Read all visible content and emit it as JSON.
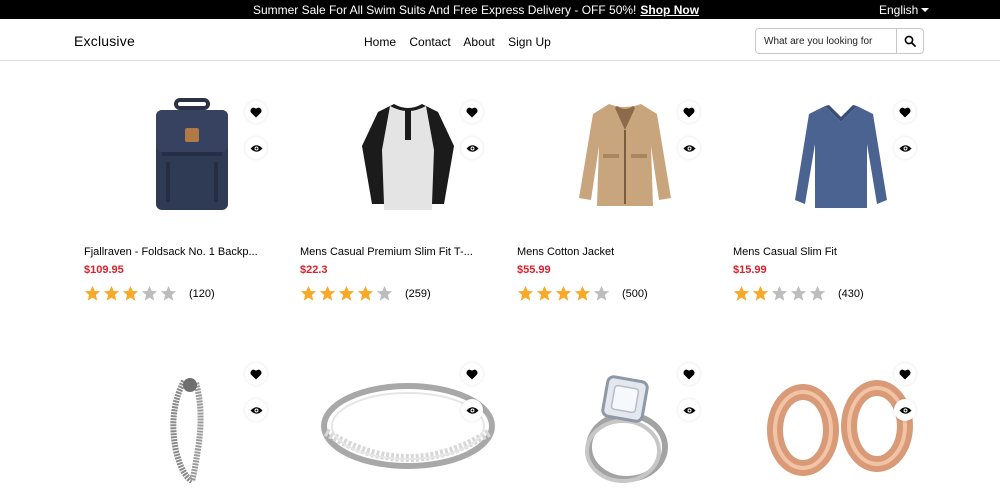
{
  "topbar": {
    "promo": "Summer Sale For All Swim Suits And Free Express Delivery - OFF 50%!",
    "shop_now": "Shop Now",
    "language": "English"
  },
  "header": {
    "logo": "Exclusive",
    "links": [
      "Home",
      "Contact",
      "About",
      "Sign Up"
    ],
    "search_placeholder": "What are you looking for"
  },
  "products": [
    {
      "title": "Fjallraven - Foldsack No. 1 Backp...",
      "price": "$109.95",
      "rating": 3,
      "count": "(120)"
    },
    {
      "title": "Mens Casual Premium Slim Fit T-...",
      "price": "$22.3",
      "rating": 4,
      "count": "(259)"
    },
    {
      "title": "Mens Cotton Jacket",
      "price": "$55.99",
      "rating": 4,
      "count": "(500)"
    },
    {
      "title": "Mens Casual Slim Fit",
      "price": "$15.99",
      "rating": 2,
      "count": "(430)"
    },
    {
      "title": "",
      "price": "",
      "rating": 0,
      "count": ""
    },
    {
      "title": "",
      "price": "",
      "rating": 0,
      "count": ""
    },
    {
      "title": "",
      "price": "",
      "rating": 0,
      "count": ""
    },
    {
      "title": "",
      "price": "",
      "rating": 0,
      "count": ""
    }
  ],
  "colors": {
    "price": "#db1f2b",
    "star_filled": "#f7a928",
    "star_empty": "#bdbdbd"
  }
}
